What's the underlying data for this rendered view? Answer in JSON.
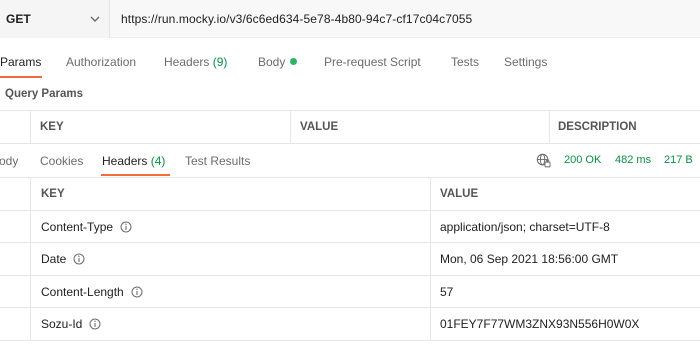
{
  "request": {
    "method": "GET",
    "url": "https://run.mocky.io/v3/6c6ed634-5e78-4b80-94c7-cf17c04c7055"
  },
  "request_tabs": {
    "params": "Params",
    "authorization": "Authorization",
    "headers_label": "Headers",
    "headers_count": "(9)",
    "body": "Body",
    "pre_request": "Pre-request Script",
    "tests": "Tests",
    "settings": "Settings"
  },
  "query_params": {
    "title": "Query Params",
    "columns": [
      "KEY",
      "VALUE",
      "DESCRIPTION"
    ]
  },
  "response_tabs": {
    "body": "Body",
    "cookies": "Cookies",
    "headers_label": "Headers",
    "headers_count": "(4)",
    "test_results": "Test Results"
  },
  "response_status": {
    "status": "200 OK",
    "time": "482 ms",
    "size": "217 B"
  },
  "response_headers": {
    "columns": [
      "KEY",
      "VALUE"
    ],
    "rows": [
      {
        "key": "Content-Type",
        "value": "application/json; charset=UTF-8"
      },
      {
        "key": "Date",
        "value": "Mon, 06 Sep 2021 18:56:00 GMT"
      },
      {
        "key": "Content-Length",
        "value": "57"
      },
      {
        "key": "Sozu-Id",
        "value": "01FEY7F77WM3ZNX93N556H0W0X"
      }
    ]
  },
  "colors": {
    "accent": "#f26b3a",
    "success": "#0b8e43",
    "dot": "#2fb364"
  }
}
